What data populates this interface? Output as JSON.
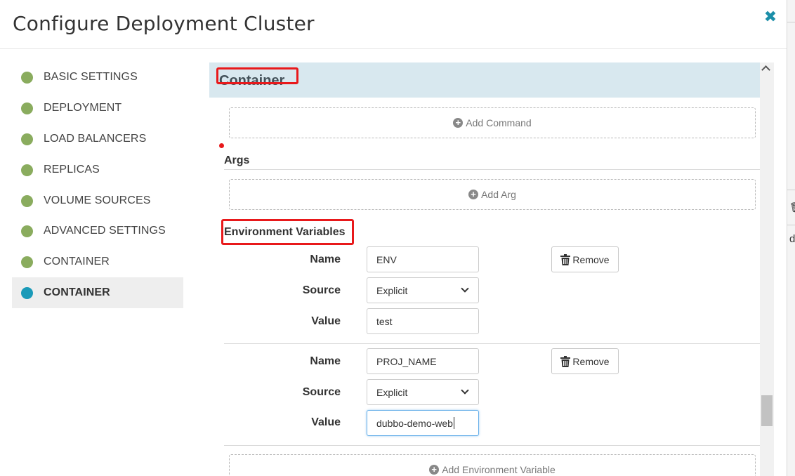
{
  "modal": {
    "title": "Configure Deployment Cluster",
    "close_glyph": "✖"
  },
  "sidebar": {
    "items": [
      {
        "label": "BASIC SETTINGS",
        "state": "complete"
      },
      {
        "label": "DEPLOYMENT",
        "state": "complete"
      },
      {
        "label": "LOAD BALANCERS",
        "state": "complete"
      },
      {
        "label": "REPLICAS",
        "state": "complete"
      },
      {
        "label": "VOLUME SOURCES",
        "state": "complete"
      },
      {
        "label": "ADVANCED SETTINGS",
        "state": "complete"
      },
      {
        "label": "CONTAINER",
        "state": "complete"
      },
      {
        "label": "CONTAINER",
        "state": "active"
      }
    ],
    "colors": {
      "complete": "#8aac5e",
      "active": "#1a9ab8"
    }
  },
  "section": {
    "title": "Container",
    "add_command": "Add Command",
    "args_label": "Args",
    "add_arg": "Add Arg",
    "env_label": "Environment Variables",
    "add_env": "Add Environment Variable"
  },
  "env_vars": [
    {
      "name_label": "Name",
      "source_label": "Source",
      "value_label": "Value",
      "name": "ENV",
      "source": "Explicit",
      "value": "test",
      "remove_label": "Remove"
    },
    {
      "name_label": "Name",
      "source_label": "Source",
      "value_label": "Value",
      "name": "PROJ_NAME",
      "source": "Explicit",
      "value": "dubbo-demo-web",
      "remove_label": "Remove"
    }
  ],
  "colors": {
    "accent": "#1a9ab8",
    "highlight": "#e8191b",
    "section_bg": "#d8e8ef"
  },
  "background_page": {
    "glyph_a": "🗑",
    "glyph_b": "d"
  }
}
